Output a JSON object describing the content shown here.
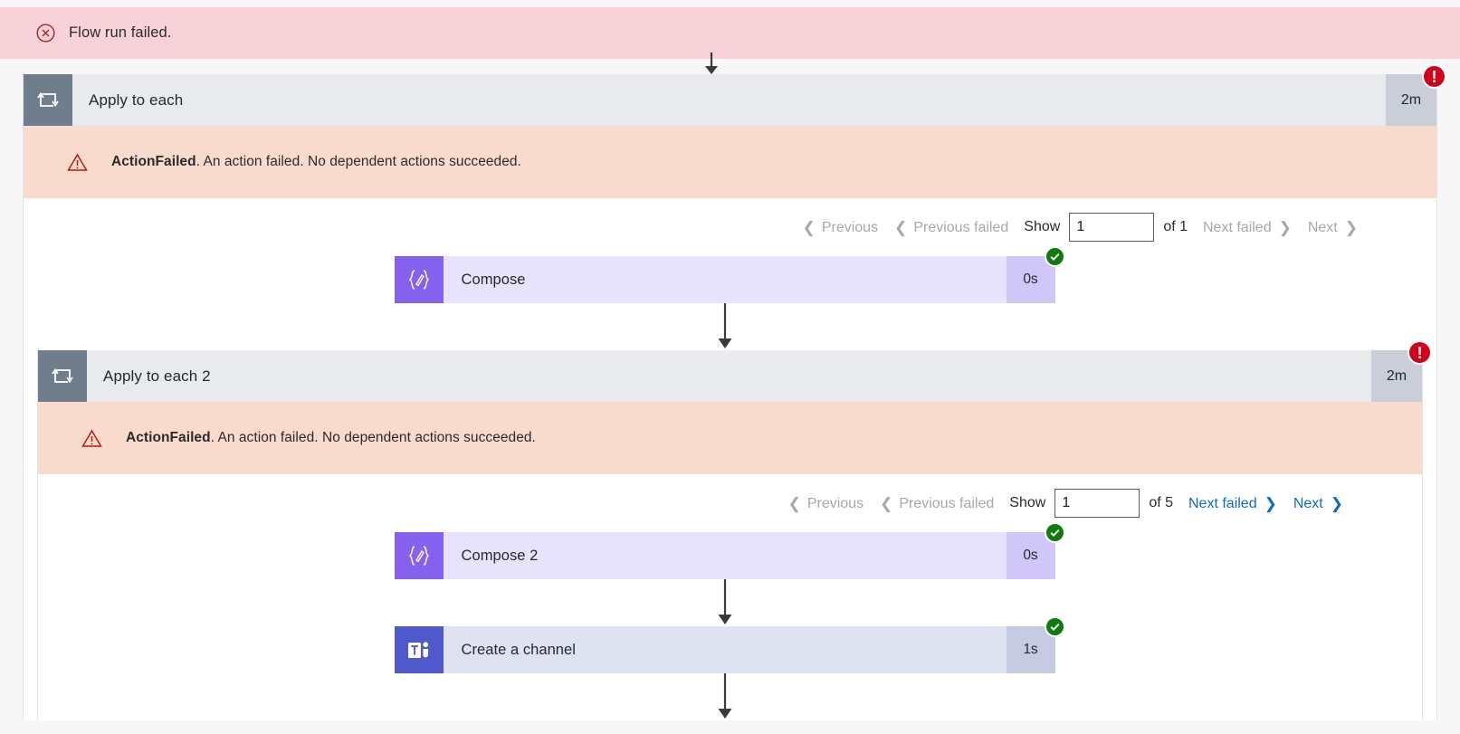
{
  "banner": {
    "text": "Flow run failed.",
    "icon": "error-circle-x-icon",
    "bg_color": "#f7d3d9",
    "accent_color": "#a4262c"
  },
  "colors": {
    "fail_badge": "#d0021b",
    "ok_badge": "#107c10",
    "loop_icon_bg": "#6f7d8c",
    "loop_header_bg": "#e9eaee",
    "loop_duration_bg": "#c9ced8",
    "error_strip_bg": "#f9dbcd",
    "compose_icon_bg": "#8661f0",
    "compose_body_bg": "#e8e3fc",
    "teams_icon_bg": "#5059c9",
    "teams_body_bg": "#dfe2f0",
    "link_enabled": "#0f6cbd",
    "link_disabled": "#a8a8a8"
  },
  "outer_scope": {
    "header": {
      "title": "Apply to each",
      "icon": "loop-repeat-icon",
      "duration": "2m",
      "status": "failed",
      "status_icon": "error-exclamation-icon"
    },
    "error": {
      "icon": "warning-triangle-icon",
      "code": "ActionFailed",
      "message": ". An action failed. No dependent actions succeeded."
    },
    "pager": {
      "previous_label": "Previous",
      "previous_failed_label": "Previous failed",
      "show_label": "Show",
      "page_value": "1",
      "page_placeholder": "",
      "of_label": "of 1",
      "next_failed_label": "Next failed",
      "next_label": "Next",
      "previous_enabled": false,
      "previous_failed_enabled": false,
      "next_failed_enabled": false,
      "next_enabled": false
    },
    "action": {
      "title": "Compose",
      "icon": "compose-braces-pencil-icon",
      "duration": "0s",
      "status": "succeeded",
      "status_icon": "success-check-icon"
    }
  },
  "inner_scope": {
    "header": {
      "title": "Apply to each 2",
      "icon": "loop-repeat-icon",
      "duration": "2m",
      "status": "failed",
      "status_icon": "error-exclamation-icon"
    },
    "error": {
      "icon": "warning-triangle-icon",
      "code": "ActionFailed",
      "message": ". An action failed. No dependent actions succeeded."
    },
    "pager": {
      "previous_label": "Previous",
      "previous_failed_label": "Previous failed",
      "show_label": "Show",
      "page_value": "1",
      "page_placeholder": "",
      "of_label": "of 5",
      "next_failed_label": "Next failed",
      "next_label": "Next",
      "previous_enabled": false,
      "previous_failed_enabled": false,
      "next_failed_enabled": true,
      "next_enabled": true
    },
    "actions": [
      {
        "title": "Compose 2",
        "icon": "compose-braces-pencil-icon",
        "duration": "0s",
        "status": "succeeded",
        "status_icon": "success-check-icon"
      },
      {
        "title": "Create a channel",
        "icon": "microsoft-teams-icon",
        "duration": "1s",
        "status": "succeeded",
        "status_icon": "success-check-icon"
      }
    ]
  },
  "chevrons": {
    "left": "❮",
    "right": "❯"
  },
  "glyphs": {
    "exclamation": "!"
  }
}
